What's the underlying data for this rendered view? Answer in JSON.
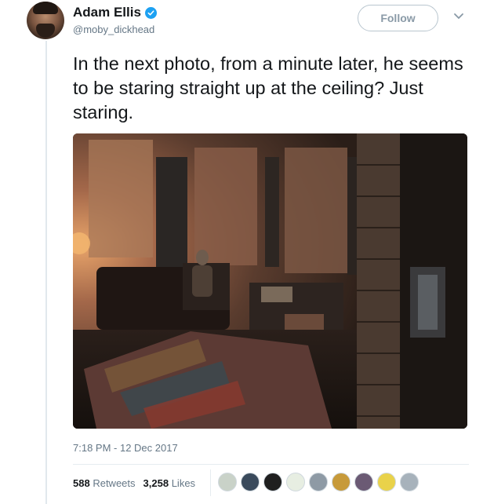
{
  "author": {
    "name": "Adam Ellis",
    "handle": "@moby_dickhead",
    "verified": true
  },
  "follow_button": {
    "label": "Follow"
  },
  "tweet": {
    "text": "In the next photo, from a minute later, he seems to be staring straight up at the ceiling? Just staring.",
    "timestamp": "7:18 PM - 12 Dec 2017"
  },
  "stats": {
    "retweets_count": "588",
    "retweets_label": "Retweets",
    "likes_count": "3,258",
    "likes_label": "Likes"
  },
  "liker_avatars": [
    "#c9d2c8",
    "#3a4a5c",
    "#1f1f1f",
    "#e7eee2",
    "#8e9aa5",
    "#c79a3a",
    "#6b5a74",
    "#e9d24a",
    "#a7b2bb"
  ],
  "colors": {
    "accent": "#1da1f2",
    "text": "#14171a",
    "muted": "#657786"
  }
}
